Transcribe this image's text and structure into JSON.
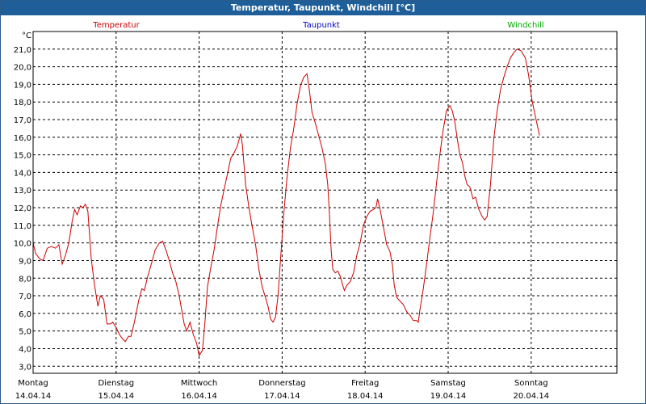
{
  "window": {
    "title": "Temperatur, Taupunkt, Windchill [°C]"
  },
  "chart_data": {
    "type": "line",
    "title": "Temperatur, Taupunkt, Windchill [°C]",
    "ylabel": "°C",
    "ylim": [
      2.6,
      22.0
    ],
    "yticks": [
      "21,0",
      "20,0",
      "19,0",
      "18,0",
      "17,0",
      "16,0",
      "15,0",
      "14,0",
      "13,0",
      "12,0",
      "11,0",
      "10,0",
      "9,0",
      "8,0",
      "7,0",
      "6,0",
      "5,0",
      "4,0",
      "3,0"
    ],
    "xlim": [
      0,
      7.0
    ],
    "day_ticks": [
      {
        "day": "Montag",
        "date": "14.04.14"
      },
      {
        "day": "Dienstag",
        "date": "15.04.14"
      },
      {
        "day": "Mittwoch",
        "date": "16.04.14"
      },
      {
        "day": "Donnerstag",
        "date": "17.04.14"
      },
      {
        "day": "Freitag",
        "date": "18.04.14"
      },
      {
        "day": "Samstag",
        "date": "19.04.14"
      },
      {
        "day": "Sonntag",
        "date": "20.04.14"
      }
    ],
    "grid": true,
    "legend": "top",
    "series": [
      {
        "name": "Temperatur",
        "color": "#cc0000",
        "values": [
          [
            0.0,
            10.0
          ],
          [
            0.03,
            9.4
          ],
          [
            0.08,
            9.1
          ],
          [
            0.12,
            9.0
          ],
          [
            0.17,
            9.7
          ],
          [
            0.22,
            9.8
          ],
          [
            0.27,
            9.7
          ],
          [
            0.31,
            9.9
          ],
          [
            0.35,
            8.8
          ],
          [
            0.39,
            9.3
          ],
          [
            0.43,
            10.0
          ],
          [
            0.47,
            11.2
          ],
          [
            0.5,
            11.9
          ],
          [
            0.53,
            11.6
          ],
          [
            0.57,
            12.1
          ],
          [
            0.6,
            12.0
          ],
          [
            0.63,
            12.2
          ],
          [
            0.66,
            11.8
          ],
          [
            0.7,
            9.1
          ],
          [
            0.74,
            7.6
          ],
          [
            0.78,
            6.4
          ],
          [
            0.81,
            7.0
          ],
          [
            0.85,
            6.8
          ],
          [
            0.89,
            5.4
          ],
          [
            0.93,
            5.4
          ],
          [
            0.96,
            5.5
          ],
          [
            1.0,
            5.2
          ],
          [
            1.04,
            4.8
          ],
          [
            1.07,
            4.6
          ],
          [
            1.11,
            4.4
          ],
          [
            1.15,
            4.7
          ],
          [
            1.18,
            4.7
          ],
          [
            1.22,
            5.5
          ],
          [
            1.27,
            6.7
          ],
          [
            1.31,
            7.4
          ],
          [
            1.34,
            7.3
          ],
          [
            1.38,
            8.1
          ],
          [
            1.43,
            8.9
          ],
          [
            1.47,
            9.6
          ],
          [
            1.52,
            10.0
          ],
          [
            1.56,
            10.1
          ],
          [
            1.6,
            9.6
          ],
          [
            1.64,
            9.0
          ],
          [
            1.68,
            8.3
          ],
          [
            1.72,
            7.8
          ],
          [
            1.76,
            7.0
          ],
          [
            1.79,
            6.2
          ],
          [
            1.82,
            5.4
          ],
          [
            1.85,
            5.0
          ],
          [
            1.89,
            5.5
          ],
          [
            1.93,
            4.8
          ],
          [
            1.97,
            4.3
          ],
          [
            2.0,
            3.6
          ],
          [
            2.04,
            3.9
          ],
          [
            2.07,
            5.5
          ],
          [
            2.1,
            7.5
          ],
          [
            2.14,
            8.6
          ],
          [
            2.18,
            9.6
          ],
          [
            2.22,
            10.9
          ],
          [
            2.26,
            12.1
          ],
          [
            2.3,
            13.0
          ],
          [
            2.34,
            13.9
          ],
          [
            2.38,
            14.8
          ],
          [
            2.42,
            15.1
          ],
          [
            2.46,
            15.5
          ],
          [
            2.5,
            16.2
          ],
          [
            2.52,
            15.6
          ],
          [
            2.56,
            13.3
          ],
          [
            2.6,
            12.0
          ],
          [
            2.64,
            10.9
          ],
          [
            2.68,
            9.9
          ],
          [
            2.72,
            8.5
          ],
          [
            2.76,
            7.5
          ],
          [
            2.8,
            6.9
          ],
          [
            2.83,
            6.4
          ],
          [
            2.86,
            5.7
          ],
          [
            2.89,
            5.5
          ],
          [
            2.92,
            5.8
          ],
          [
            2.95,
            7.0
          ],
          [
            2.98,
            9.0
          ],
          [
            3.02,
            11.7
          ],
          [
            3.06,
            13.8
          ],
          [
            3.1,
            15.4
          ],
          [
            3.14,
            16.5
          ],
          [
            3.18,
            17.9
          ],
          [
            3.22,
            18.9
          ],
          [
            3.26,
            19.4
          ],
          [
            3.3,
            19.6
          ],
          [
            3.33,
            18.6
          ],
          [
            3.36,
            17.4
          ],
          [
            3.4,
            16.8
          ],
          [
            3.44,
            16.1
          ],
          [
            3.48,
            15.4
          ],
          [
            3.52,
            14.5
          ],
          [
            3.55,
            13.3
          ],
          [
            3.57,
            11.6
          ],
          [
            3.59,
            9.6
          ],
          [
            3.61,
            8.5
          ],
          [
            3.64,
            8.3
          ],
          [
            3.67,
            8.4
          ],
          [
            3.7,
            8.1
          ],
          [
            3.73,
            7.6
          ],
          [
            3.75,
            7.3
          ],
          [
            3.78,
            7.6
          ],
          [
            3.82,
            7.8
          ],
          [
            3.86,
            8.3
          ],
          [
            3.9,
            9.3
          ],
          [
            3.94,
            10.0
          ],
          [
            3.98,
            11.0
          ],
          [
            4.02,
            11.5
          ],
          [
            4.06,
            11.8
          ],
          [
            4.1,
            11.9
          ],
          [
            4.13,
            12.0
          ],
          [
            4.15,
            12.5
          ],
          [
            4.18,
            11.9
          ],
          [
            4.22,
            10.9
          ],
          [
            4.26,
            9.9
          ],
          [
            4.3,
            9.5
          ],
          [
            4.33,
            8.7
          ],
          [
            4.35,
            7.6
          ],
          [
            4.38,
            6.9
          ],
          [
            4.42,
            6.7
          ],
          [
            4.46,
            6.5
          ],
          [
            4.5,
            6.1
          ],
          [
            4.54,
            5.9
          ],
          [
            4.58,
            5.6
          ],
          [
            4.62,
            5.6
          ],
          [
            4.64,
            5.5
          ],
          [
            4.66,
            6.2
          ],
          [
            4.7,
            7.4
          ],
          [
            4.74,
            8.8
          ],
          [
            4.78,
            10.3
          ],
          [
            4.82,
            11.7
          ],
          [
            4.86,
            13.4
          ],
          [
            4.9,
            15.0
          ],
          [
            4.94,
            16.4
          ],
          [
            4.98,
            17.5
          ],
          [
            5.02,
            17.8
          ],
          [
            5.05,
            17.5
          ],
          [
            5.08,
            16.9
          ],
          [
            5.11,
            15.9
          ],
          [
            5.14,
            15.0
          ],
          [
            5.17,
            14.6
          ],
          [
            5.2,
            13.8
          ],
          [
            5.23,
            13.3
          ],
          [
            5.26,
            13.2
          ],
          [
            5.3,
            12.5
          ],
          [
            5.33,
            12.6
          ],
          [
            5.37,
            11.9
          ],
          [
            5.41,
            11.5
          ],
          [
            5.44,
            11.3
          ],
          [
            5.47,
            11.5
          ],
          [
            5.51,
            13.3
          ],
          [
            5.55,
            15.9
          ],
          [
            5.59,
            17.5
          ],
          [
            5.63,
            18.7
          ],
          [
            5.67,
            19.4
          ],
          [
            5.71,
            20.0
          ],
          [
            5.75,
            20.5
          ],
          [
            5.79,
            20.8
          ],
          [
            5.83,
            21.0
          ],
          [
            5.88,
            20.9
          ],
          [
            5.93,
            20.5
          ],
          [
            5.97,
            19.5
          ],
          [
            6.01,
            18.1
          ],
          [
            6.05,
            17.2
          ],
          [
            6.1,
            16.1
          ]
        ]
      },
      {
        "name": "Taupunkt",
        "color": "#0000cc",
        "values": []
      },
      {
        "name": "Windchill",
        "color": "#00aa00",
        "values": []
      }
    ]
  }
}
